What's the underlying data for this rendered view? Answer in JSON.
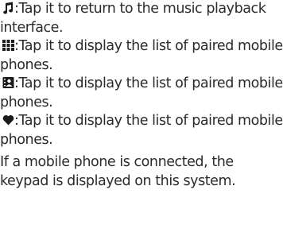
{
  "items": [
    {
      "icon": "music-note-icon",
      "text": ":Tap it to return to the music playback interface."
    },
    {
      "icon": "grid-keypad-icon",
      "text": ":Tap it to display the list of paired mobile phones."
    },
    {
      "icon": "phonebook-icon",
      "text": ":Tap it to display the list of paired mobile phones."
    },
    {
      "icon": "heart-icon",
      "text": ":Tap it to display the list of paired mobile phones."
    }
  ],
  "paragraph": "If a mobile phone is connected, the keypad is displayed on this system."
}
